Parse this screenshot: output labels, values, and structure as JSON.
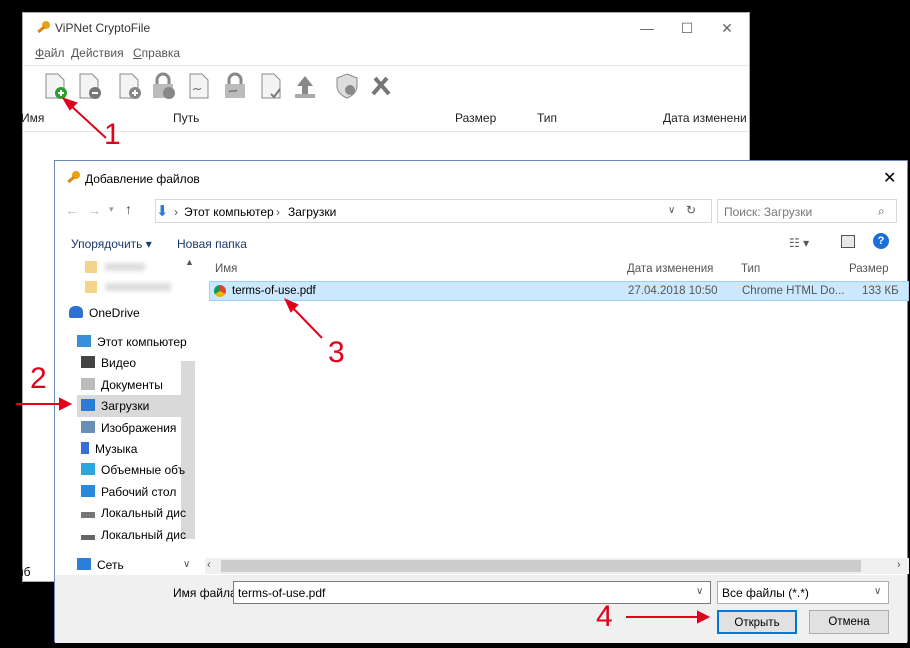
{
  "main_window": {
    "title": "ViPNet CryptoFile",
    "menu": [
      {
        "label": "Файл",
        "key": "Ф",
        "rest": "айл"
      },
      {
        "label": "Действия",
        "key": "Д",
        "rest": "ействия"
      },
      {
        "label": "Справка",
        "key": "С",
        "rest": "правка"
      }
    ],
    "toolbar_icons": [
      "add-file-icon",
      "remove-file-icon",
      "sign-file-icon",
      "encrypt-file-icon",
      "sign-encrypt-icon",
      "decrypt-icon",
      "verify-signature-icon",
      "send-icon",
      "certificate-icon",
      "settings-tools-icon"
    ],
    "columns": {
      "name": "Имя",
      "path": "Путь",
      "size": "Размер",
      "type": "Тип",
      "date": "Дата изменени"
    },
    "status_text": "Выб"
  },
  "dialog": {
    "title": "Добавление файлов",
    "breadcrumb": [
      "Этот компьютер",
      "Загрузки"
    ],
    "search_placeholder": "Поиск: Загрузки",
    "organize": "Упорядочить",
    "new_folder": "Новая папка",
    "nav_items": [
      {
        "label": "OneDrive",
        "icon": "onedrive-icon",
        "color": "#2f6fd1"
      },
      {
        "label": "Этот компьютер",
        "icon": "computer-icon",
        "color": "#3a8fd8"
      },
      {
        "label": "Видео",
        "icon": "video-icon",
        "color": "#444444"
      },
      {
        "label": "Документы",
        "icon": "documents-icon",
        "color": "#888888"
      },
      {
        "label": "Загрузки",
        "icon": "downloads-icon",
        "color": "#2b7bd8"
      },
      {
        "label": "Изображения",
        "icon": "pictures-icon",
        "color": "#6a8fb5"
      },
      {
        "label": "Музыка",
        "icon": "music-icon",
        "color": "#3a6fd8"
      },
      {
        "label": "Объемные объ",
        "icon": "3d-objects-icon",
        "color": "#2aa5e0"
      },
      {
        "label": "Рабочий стол",
        "icon": "desktop-icon",
        "color": "#2a8ad8"
      },
      {
        "label": "Локальный дис",
        "icon": "disk-c-icon",
        "color": "#777777"
      },
      {
        "label": "Локальный дис",
        "icon": "disk-d-icon",
        "color": "#666666"
      },
      {
        "label": "Сеть",
        "icon": "network-icon",
        "color": "#2a7fd8"
      }
    ],
    "columns": {
      "name": "Имя",
      "date": "Дата изменения",
      "type": "Тип",
      "size": "Размер"
    },
    "files": [
      {
        "name": "terms-of-use.pdf",
        "date": "27.04.2018 10:50",
        "type": "Chrome HTML Do...",
        "size": "133 КБ"
      }
    ],
    "filename_label": "Имя файла:",
    "filename_value": "terms-of-use.pdf",
    "filter_value": "Все файлы (*.*)",
    "open_button": "Открыть",
    "cancel_button": "Отмена"
  },
  "annotations": [
    "1",
    "2",
    "3",
    "4"
  ],
  "colors": {
    "annotation": "#e3001b",
    "selection": "#cce8ff",
    "accent": "#0078d7"
  }
}
